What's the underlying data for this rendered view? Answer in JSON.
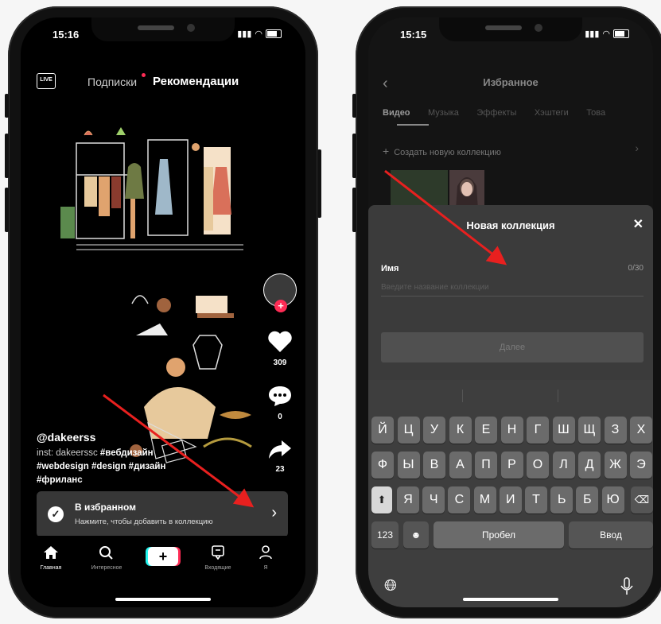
{
  "left_phone": {
    "status_time": "15:16",
    "top_nav": {
      "live_label": "LIVE",
      "following_label": "Подписки",
      "for_you_label": "Рекомендации"
    },
    "actions": {
      "likes": "309",
      "comments": "0",
      "shares": "23"
    },
    "caption": {
      "username": "@dakeerss",
      "line1_plain": "inst: dakeerssc ",
      "line1_tag": "#вебдизайн",
      "line2": "#webdesign #design #дизайн",
      "line3": "#фриланс"
    },
    "toast": {
      "title": "В избранном",
      "subtitle": "Нажмите, чтобы добавить в коллекцию"
    },
    "bottom_nav": {
      "home": "Главная",
      "discover": "Интересное",
      "inbox": "Входящие",
      "profile": "Я"
    }
  },
  "right_phone": {
    "status_time": "15:15",
    "header_title": "Избранное",
    "tabs": [
      "Видео",
      "Музыка",
      "Эффекты",
      "Хэштеги",
      "Това"
    ],
    "create_collection": "Создать новую коллекцию",
    "sheet": {
      "title": "Новая коллекция",
      "name_label": "Имя",
      "name_counter": "0/30",
      "name_placeholder": "Введите название коллекции",
      "next_label": "Далее"
    },
    "keyboard": {
      "row1": [
        "Й",
        "Ц",
        "У",
        "К",
        "Е",
        "Н",
        "Г",
        "Ш",
        "Щ",
        "З",
        "Х"
      ],
      "row2": [
        "Ф",
        "Ы",
        "В",
        "А",
        "П",
        "Р",
        "О",
        "Л",
        "Д",
        "Ж",
        "Э"
      ],
      "row3": [
        "Я",
        "Ч",
        "С",
        "М",
        "И",
        "Т",
        "Ь",
        "Б",
        "Ю"
      ],
      "numbers_key": "123",
      "space_key": "Пробел",
      "return_key": "Ввод"
    }
  },
  "colors": {
    "accent_red": "#fe2c55",
    "arrow_red": "#e8201f"
  }
}
